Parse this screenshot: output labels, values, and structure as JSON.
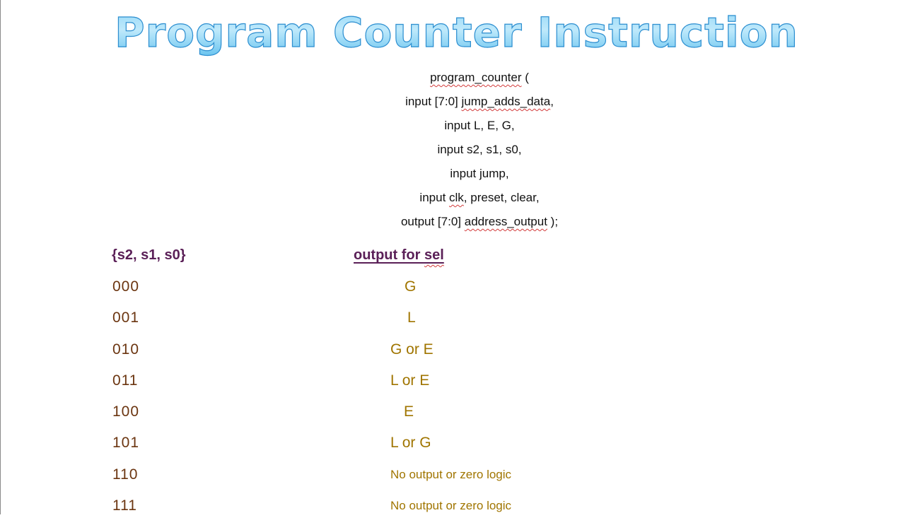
{
  "title": "Program Counter Instruction",
  "module_declaration": {
    "lines": [
      {
        "pre": "",
        "squiggle": "program_counter",
        "post": " ("
      },
      {
        "pre": "input [7:0] ",
        "squiggle": "jump_adds_data",
        "post": ","
      },
      {
        "pre": "input L, E, G,",
        "squiggle": "",
        "post": ""
      },
      {
        "pre": "input s2, s1, s0,",
        "squiggle": "",
        "post": ""
      },
      {
        "pre": "input jump,",
        "squiggle": "",
        "post": ""
      },
      {
        "pre": "input ",
        "squiggle": "clk",
        "post": ", preset, clear,"
      },
      {
        "pre": "output [7:0] ",
        "squiggle": "address_output",
        "post": " );"
      }
    ]
  },
  "table": {
    "header_select": "{s2, s1, s0}",
    "header_output_pre": "output for ",
    "header_output_squiggle": "sel",
    "colors": {
      "header": "#5a1f57",
      "select_values": "#6b3510",
      "output_values": "#a07500"
    },
    "rows": [
      {
        "select": "000",
        "output": "G"
      },
      {
        "select": "001",
        "output": "L"
      },
      {
        "select": "010",
        "output": "G or E"
      },
      {
        "select": "011",
        "output": "L or E"
      },
      {
        "select": "100",
        "output": "E"
      },
      {
        "select": "101",
        "output": "L or G"
      },
      {
        "select": "110",
        "output": "No output or zero logic"
      },
      {
        "select": "111",
        "output": "No output or zero logic"
      }
    ]
  }
}
